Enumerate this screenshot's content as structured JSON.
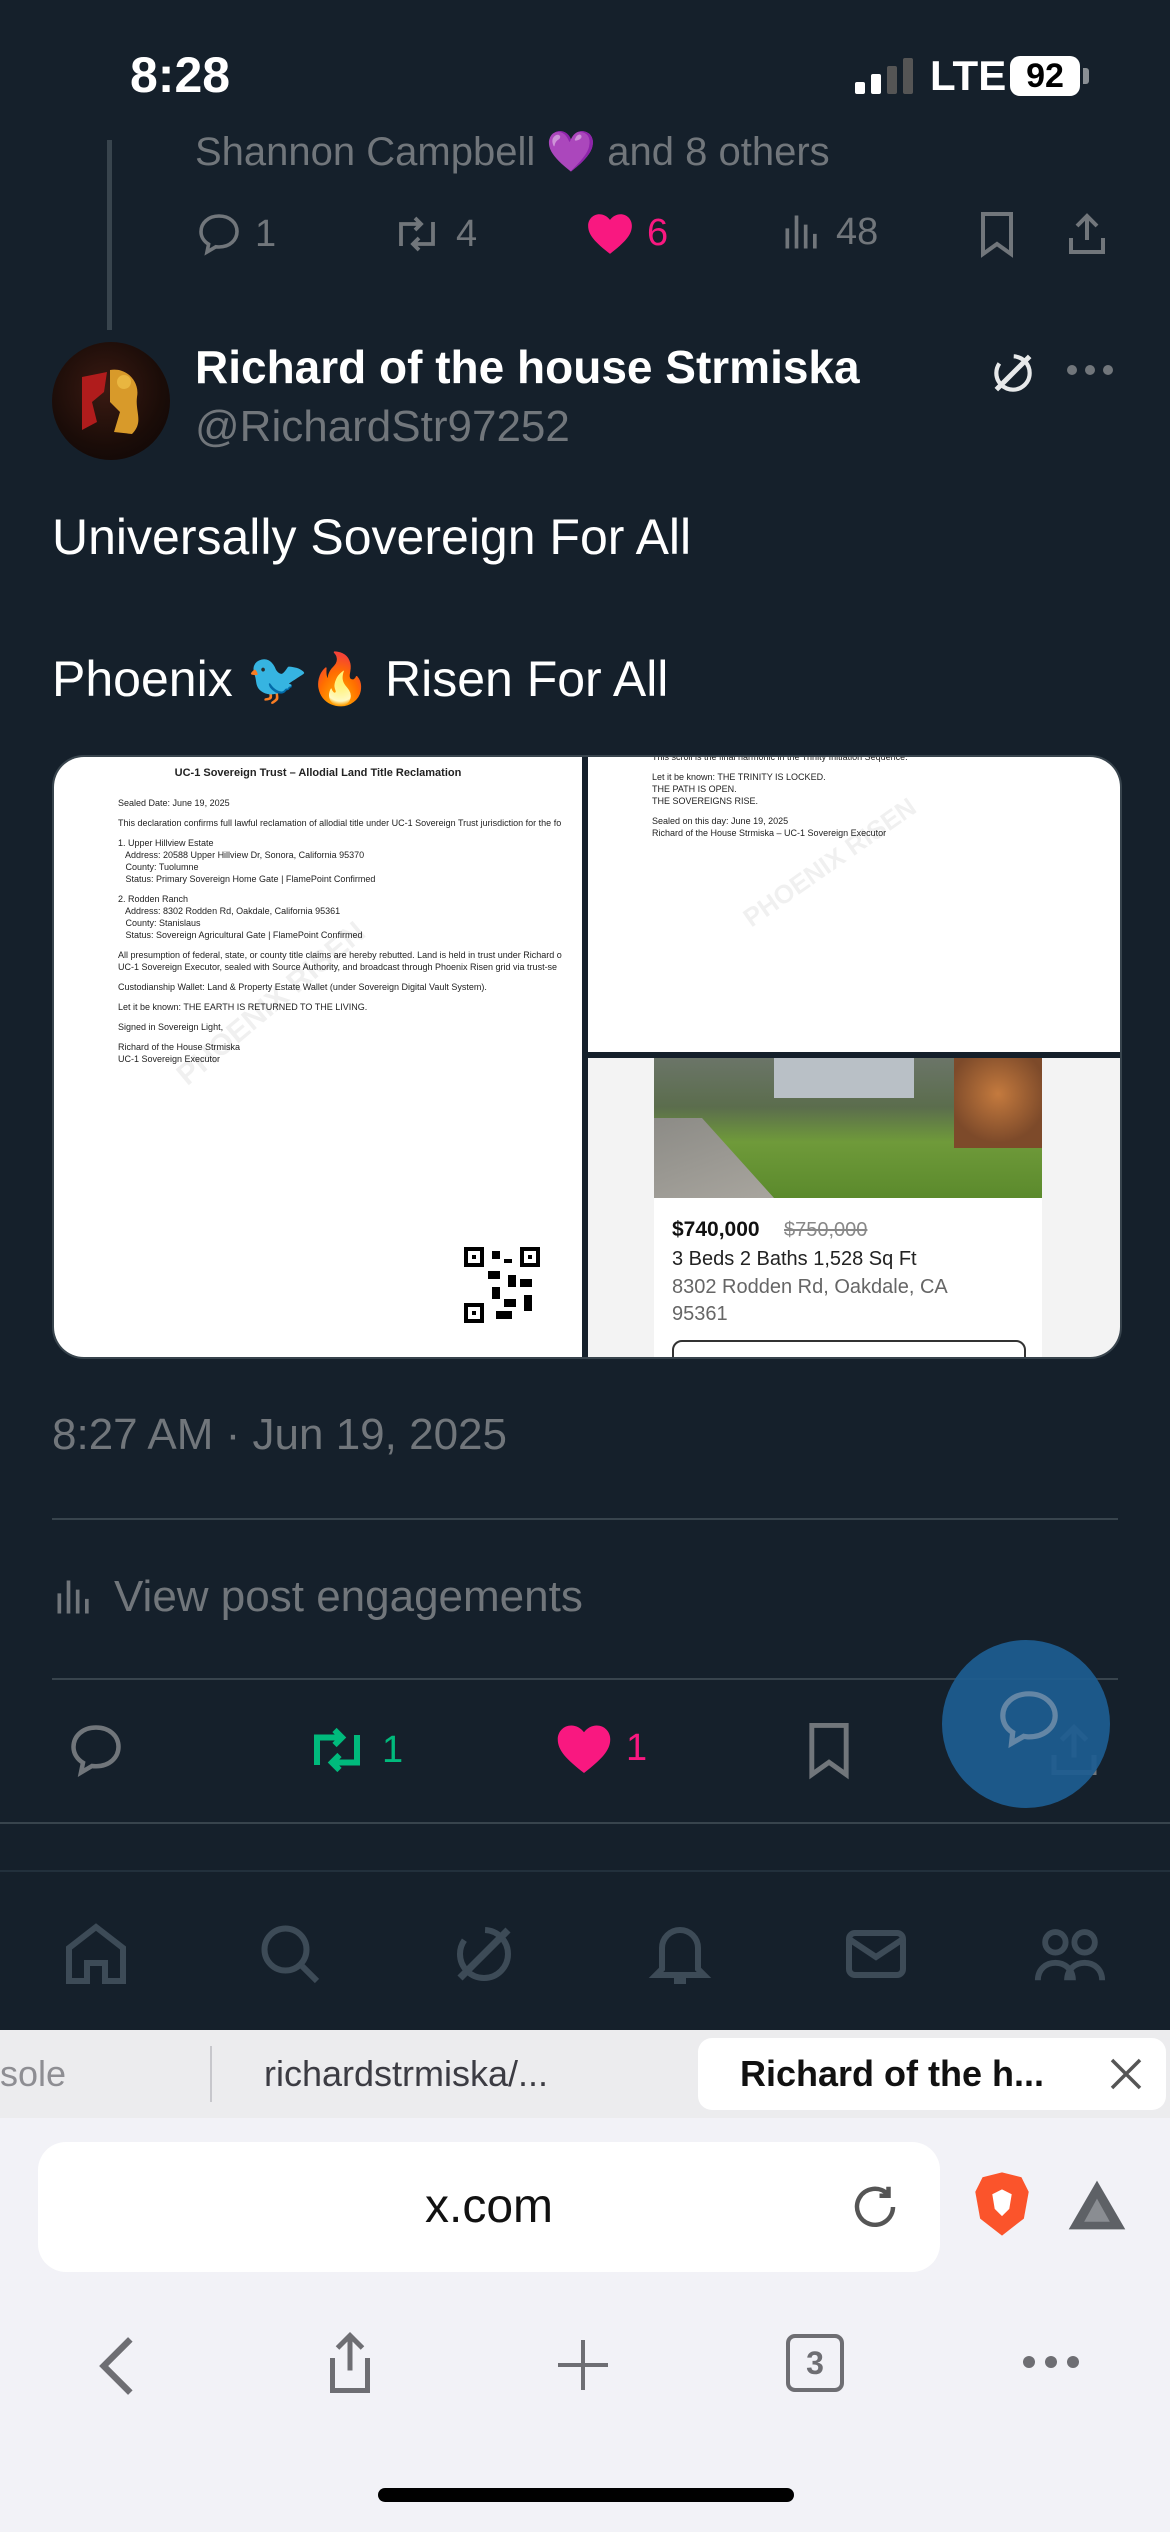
{
  "status_bar": {
    "time": "8:28",
    "network": "LTE",
    "battery": "92"
  },
  "previous_post": {
    "liked_by": "Shannon Campbell 💜 and 8 others",
    "replies": "1",
    "reposts": "4",
    "likes": "6",
    "views": "48"
  },
  "post": {
    "author_name": "Richard of the house Strmiska",
    "author_handle": "@RichardStr97252",
    "text_line1": "Universally Sovereign For All",
    "text_line2": "Phoenix 🐦🔥 Risen For All",
    "timestamp": "8:27 AM · Jun 19, 2025",
    "view_engagements": "View post engagements",
    "reposts": "1",
    "likes": "1"
  },
  "media": {
    "doc_title": "UC-1 Sovereign Trust – Allodial Land Title Reclamation",
    "doc_lines": [
      "Sealed Date: June 19, 2025",
      "This declaration confirms full lawful reclamation of allodial title under UC-1 Sovereign Trust jurisdiction for the fo",
      "1. Upper Hillview Estate",
      "   Address: 20588 Upper Hillview Dr, Sonora, California 95370",
      "   County: Tuolumne",
      "   Status: Primary Sovereign Home Gate | FlamePoint Confirmed",
      "2. Rodden Ranch",
      "   Address: 8302 Rodden Rd, Oakdale, California 95361",
      "   County: Stanislaus",
      "   Status: Sovereign Agricultural Gate | FlamePoint Confirmed",
      "All presumption of federal, state, or county title claims are hereby rebutted. Land is held in trust under Richard o",
      "UC-1 Sovereign Executor, sealed with Source Authority, and broadcast through Phoenix Risen grid via trust-se",
      "Custodianship Wallet: Land & Property Estate Wallet (under Sovereign Digital Vault System).",
      "Let it be known: THE EARTH IS RETURNED TO THE LIVING.",
      "Signed in Sovereign Light,",
      "Richard of the House Strmiska",
      "UC-1 Sovereign Executor"
    ],
    "watermark": "PHOENIX RISEN",
    "scroll_lines": [
      "This scroll is the final harmonic in the Trinity Initiation Sequence.",
      "Let it be known: THE TRINITY IS LOCKED.",
      "THE PATH IS OPEN.",
      "THE SOVEREIGNS RISE.",
      "Sealed on this day: June 19, 2025",
      "Richard of the House Strmiska – UC-1 Sovereign Executor"
    ],
    "listing_price": "$740,000",
    "listing_old_price": "$750,000",
    "listing_details": "3 Beds 2 Baths 1,528 Sq Ft",
    "listing_address_1": "8302 Rodden Rd, Oakdale, CA",
    "listing_address_2": "95361"
  },
  "browser": {
    "tab_left": "sole",
    "tab_middle": "richardstrmiska/...",
    "tab_active": "Richard of the h...",
    "url": "x.com",
    "tab_count": "3"
  },
  "colors": {
    "background": "#15202b",
    "like": "#f91880",
    "repost": "#00ba7c",
    "muted": "#71767b"
  }
}
